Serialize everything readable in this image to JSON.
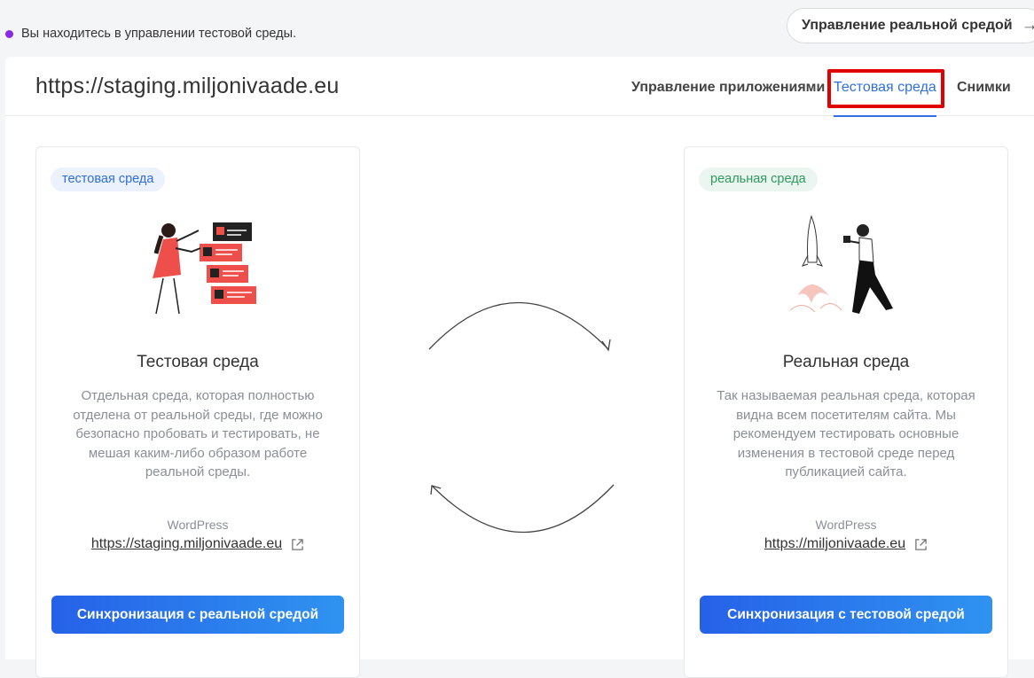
{
  "notice": {
    "text": "Вы находитесь в управлении тестовой среды.",
    "dot_color": "#8a2be2"
  },
  "top_button": {
    "label": "Управление реальной средой",
    "icon": "arrow-right-icon"
  },
  "header": {
    "site_url": "https://staging.miljonivaade.eu",
    "tabs": [
      {
        "label": "Управление приложениями",
        "active": false
      },
      {
        "label": "Тестовая среда",
        "active": true
      },
      {
        "label": "Снимки",
        "active": false
      }
    ]
  },
  "staging_card": {
    "badge": "тестовая среда",
    "title": "Тестовая среда",
    "description": "Отдельная среда, которая полностью отделена от реальной среды, где можно безопасно пробовать и тестировать, не мешая каким-либо образом работе реальной среды.",
    "cms": "WordPress",
    "url": "https://staging.miljonivaade.eu",
    "sync_button": "Синхронизация с реальной средой"
  },
  "live_card": {
    "badge": "реальная среда",
    "title": "Реальная среда",
    "description": "Так называемая реальная среда, которая видна всем посетителям сайта. Мы рекомендуем тестировать основные изменения в тестовой среде перед публикацией сайта.",
    "cms": "WordPress",
    "url": "https://miljonivaade.eu",
    "sync_button": "Синхронизация с тестовой средой"
  },
  "colors": {
    "accent": "#2f6fe0",
    "highlight": "#e00000",
    "live_badge": "#2f9a5e"
  }
}
